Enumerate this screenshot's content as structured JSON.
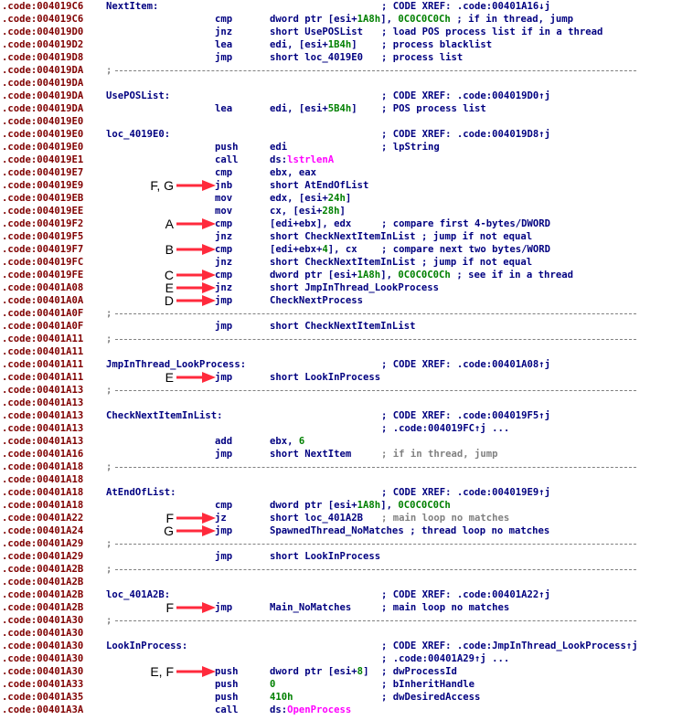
{
  "lines": [
    {
      "addr": ".code:004019C6",
      "label": "NextItem:",
      "mn": "",
      "op": "",
      "cm": "; CODE XREF: .code:00401A16↓j"
    },
    {
      "addr": ".code:004019C6",
      "label": "",
      "mn": "cmp",
      "op": "dword ptr [esi+1A8h], 0C0C0C0Ch",
      "cm": "; if in thread, jump",
      "cmoff": true
    },
    {
      "addr": ".code:004019D0",
      "label": "",
      "mn": "jnz",
      "op": "short UsePOSList",
      "cm": "; load POS process list if in a thread",
      "cmoff": true
    },
    {
      "addr": ".code:004019D2",
      "label": "",
      "mn": "lea",
      "op": "edi, [esi+1B4h]",
      "cm": "; process blacklist",
      "cmoff": true
    },
    {
      "addr": ".code:004019D8",
      "label": "",
      "mn": "jmp",
      "op": "short loc_4019E0",
      "cm": "; process list",
      "cmoff": true
    },
    {
      "addr": ".code:004019DA",
      "sep": true
    },
    {
      "addr": ".code:004019DA"
    },
    {
      "addr": ".code:004019DA",
      "label": "UsePOSList:",
      "mn": "",
      "op": "",
      "cm": "; CODE XREF: .code:004019D0↑j"
    },
    {
      "addr": ".code:004019DA",
      "label": "",
      "mn": "lea",
      "op": "edi, [esi+5B4h]",
      "cm": "; POS process list",
      "cmoff": true
    },
    {
      "addr": ".code:004019E0"
    },
    {
      "addr": ".code:004019E0",
      "label": "loc_4019E0:",
      "mn": "",
      "op": "",
      "cm": "; CODE XREF: .code:004019D8↑j"
    },
    {
      "addr": ".code:004019E0",
      "label": "",
      "mn": "push",
      "op": "edi",
      "cm": "; lpString"
    },
    {
      "addr": ".code:004019E1",
      "label": "",
      "mn": "call",
      "op": "ds:lstrlenA",
      "cm": ""
    },
    {
      "addr": ".code:004019E7",
      "label": "",
      "mn": "cmp",
      "op": "ebx, eax",
      "cm": ""
    },
    {
      "addr": ".code:004019E9",
      "label": "",
      "mn": "jnb",
      "op": "short AtEndOfList",
      "cm": ""
    },
    {
      "addr": ".code:004019EB",
      "label": "",
      "mn": "mov",
      "op": "edx, [esi+24h]",
      "cm": ""
    },
    {
      "addr": ".code:004019EE",
      "label": "",
      "mn": "mov",
      "op": "cx, [esi+28h]",
      "cm": ""
    },
    {
      "addr": ".code:004019F2",
      "label": "",
      "mn": "cmp",
      "op": "[edi+ebx], edx",
      "cm": "; compare first 4-bytes/DWORD",
      "cmoff": true
    },
    {
      "addr": ".code:004019F5",
      "label": "",
      "mn": "jnz",
      "op": "short CheckNextItemInList",
      "cm": "; jump if not equal",
      "cmoff": true
    },
    {
      "addr": ".code:004019F7",
      "label": "",
      "mn": "cmp",
      "op": "[edi+ebx+4], cx",
      "cm": "; compare next two bytes/WORD",
      "cmoff": true
    },
    {
      "addr": ".code:004019FC",
      "label": "",
      "mn": "jnz",
      "op": "short CheckNextItemInList",
      "cm": "; jump if not equal",
      "cmoff": true
    },
    {
      "addr": ".code:004019FE",
      "label": "",
      "mn": "cmp",
      "op": "dword ptr [esi+1A8h], 0C0C0C0Ch",
      "cm": "; see if in a thread",
      "cmoff": true
    },
    {
      "addr": ".code:00401A08",
      "label": "",
      "mn": "jnz",
      "op": "short JmpInThread_LookProcess",
      "cm": ""
    },
    {
      "addr": ".code:00401A0A",
      "label": "",
      "mn": "jmp",
      "op": "CheckNextProcess",
      "cm": ""
    },
    {
      "addr": ".code:00401A0F",
      "sep": true
    },
    {
      "addr": ".code:00401A0F",
      "label": "",
      "mn": "jmp",
      "op": "short CheckNextItemInList",
      "cm": ""
    },
    {
      "addr": ".code:00401A11",
      "sep": true
    },
    {
      "addr": ".code:00401A11"
    },
    {
      "addr": ".code:00401A11",
      "label": "JmpInThread_LookProcess:",
      "mn": "",
      "op": "",
      "cm": "; CODE XREF: .code:00401A08↑j"
    },
    {
      "addr": ".code:00401A11",
      "label": "",
      "mn": "jmp",
      "op": "short LookInProcess",
      "cm": ""
    },
    {
      "addr": ".code:00401A13",
      "sep": true
    },
    {
      "addr": ".code:00401A13"
    },
    {
      "addr": ".code:00401A13",
      "label": "CheckNextItemInList:",
      "mn": "",
      "op": "",
      "cm": "; CODE XREF: .code:004019F5↑j"
    },
    {
      "addr": ".code:00401A13",
      "label": "",
      "mn": "",
      "op": "",
      "cm": "; .code:004019FC↑j ..."
    },
    {
      "addr": ".code:00401A13",
      "label": "",
      "mn": "add",
      "op": "ebx, 6",
      "cm": ""
    },
    {
      "addr": ".code:00401A16",
      "label": "",
      "mn": "jmp",
      "op": "short NextItem",
      "cm": "; if in thread, jump",
      "cmoff": true,
      "gray": true
    },
    {
      "addr": ".code:00401A18",
      "sep": true
    },
    {
      "addr": ".code:00401A18"
    },
    {
      "addr": ".code:00401A18",
      "label": "AtEndOfList:",
      "mn": "",
      "op": "",
      "cm": "; CODE XREF: .code:004019E9↑j"
    },
    {
      "addr": ".code:00401A18",
      "label": "",
      "mn": "cmp",
      "op": "dword ptr [esi+1A8h], 0C0C0C0Ch",
      "cm": ""
    },
    {
      "addr": ".code:00401A22",
      "label": "",
      "mn": "jz",
      "op": "short loc_401A2B",
      "cm": "; main loop no matches",
      "cmoff": true,
      "gray": true
    },
    {
      "addr": ".code:00401A24",
      "label": "",
      "mn": "jmp",
      "op": "SpawnedThread_NoMatches",
      "cm": "; thread loop no matches",
      "cmoff": true
    },
    {
      "addr": ".code:00401A29",
      "sep": true
    },
    {
      "addr": ".code:00401A29",
      "label": "",
      "mn": "jmp",
      "op": "short LookInProcess",
      "cm": ""
    },
    {
      "addr": ".code:00401A2B",
      "sep": true
    },
    {
      "addr": ".code:00401A2B"
    },
    {
      "addr": ".code:00401A2B",
      "label": "loc_401A2B:",
      "mn": "",
      "op": "",
      "cm": "; CODE XREF: .code:00401A22↑j"
    },
    {
      "addr": ".code:00401A2B",
      "label": "",
      "mn": "jmp",
      "op": "Main_NoMatches",
      "cm": "; main loop no matches",
      "cmoff": true
    },
    {
      "addr": ".code:00401A30",
      "sep": true
    },
    {
      "addr": ".code:00401A30"
    },
    {
      "addr": ".code:00401A30",
      "label": "LookInProcess:",
      "mn": "",
      "op": "",
      "cm": "; CODE XREF: .code:JmpInThread_LookProcess↑j"
    },
    {
      "addr": ".code:00401A30",
      "label": "",
      "mn": "",
      "op": "",
      "cm": "; .code:00401A29↑j ..."
    },
    {
      "addr": ".code:00401A30",
      "label": "",
      "mn": "push",
      "op": "dword ptr [esi+8]",
      "cm": "; dwProcessId",
      "cmoff": true
    },
    {
      "addr": ".code:00401A33",
      "label": "",
      "mn": "push",
      "op": "0",
      "cm": "; bInheritHandle"
    },
    {
      "addr": ".code:00401A35",
      "label": "",
      "mn": "push",
      "op": "410h",
      "cm": "; dwDesiredAccess"
    },
    {
      "addr": ".code:00401A3A",
      "label": "",
      "mn": "call",
      "op": "ds:OpenProcess",
      "cm": ""
    }
  ],
  "annotations": [
    {
      "text": "F, G",
      "line": 14
    },
    {
      "text": "A",
      "line": 17
    },
    {
      "text": "B",
      "line": 19
    },
    {
      "text": "C",
      "line": 21
    },
    {
      "text": "E",
      "line": 22
    },
    {
      "text": "D",
      "line": 23
    },
    {
      "text": "E",
      "line": 29
    },
    {
      "text": "F",
      "line": 40
    },
    {
      "text": "G",
      "line": 41
    },
    {
      "text": "F",
      "line": 47
    },
    {
      "text": "E, F",
      "line": 52
    }
  ],
  "colors": {
    "address": "#800000",
    "code": "#000080",
    "api": "#ff00ff",
    "number": "#008000",
    "comment_gray": "#808080",
    "arrow": "#ff2a3c"
  }
}
